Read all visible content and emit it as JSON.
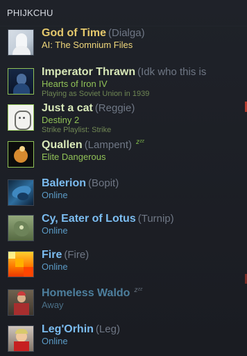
{
  "title": "PHIJKCHU",
  "friends": [
    {
      "name": "God of Time",
      "nickname": "(Dialga)",
      "status": "AI: The Somnium Files",
      "detail": "",
      "state": "in-game",
      "icon": "avatar-pale-figure"
    },
    {
      "name": "Imperator Thrawn",
      "nickname": "(Idk who this is",
      "status": "Hearts of Iron IV",
      "detail": "Playing as Soviet Union in 1939",
      "state": "in-game",
      "icon": "avatar-blue-portrait"
    },
    {
      "name": "Just a cat",
      "nickname": "(Reggie)",
      "status": "Destiny 2",
      "detail": "Strike Playlist: Strike",
      "state": "in-game",
      "icon": "avatar-sketch-cat"
    },
    {
      "name": "Quallen",
      "nickname": "(Lampent)",
      "status": "Elite Dangerous",
      "detail": "",
      "state": "in-game-away",
      "icon": "avatar-night-figure"
    },
    {
      "name": "Balerion",
      "nickname": "(Bopit)",
      "status": "Online",
      "detail": "",
      "state": "online",
      "icon": "avatar-blue-dragon"
    },
    {
      "name": "Cy, Eater of Lotus",
      "nickname": "(Turnip)",
      "status": "Online",
      "detail": "",
      "state": "online",
      "icon": "avatar-green-creature"
    },
    {
      "name": "Fire",
      "nickname": "(Fire)",
      "status": "Online",
      "detail": "",
      "state": "online",
      "icon": "avatar-fire"
    },
    {
      "name": "Homeless Waldo",
      "nickname": "",
      "status": "Away",
      "detail": "",
      "state": "away",
      "icon": "avatar-waldo"
    },
    {
      "name": "Leg'Orhin",
      "nickname": "(Leg)",
      "status": "Online",
      "detail": "",
      "state": "online",
      "icon": "avatar-character"
    }
  ],
  "zzz": "zᶻᶻ",
  "colors": {
    "background": "#1d2026",
    "in_game": "#91c257",
    "online": "#5b9bc6",
    "away": "#4b7088",
    "golden": "#f0d77b"
  }
}
